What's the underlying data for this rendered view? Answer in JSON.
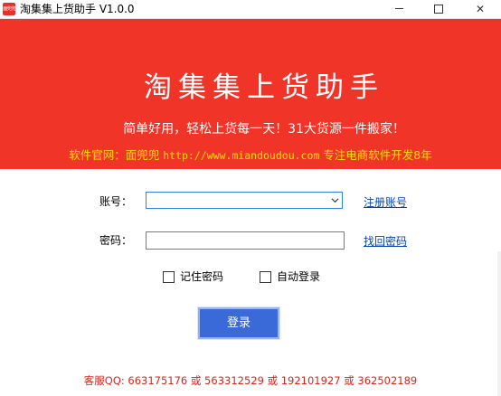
{
  "window": {
    "title": "淘集集上货助手 V1.0.0",
    "icon_text": "面兜兜",
    "controls": {
      "minimize": "minimize",
      "maximize": "maximize",
      "close": "✕"
    }
  },
  "banner": {
    "title": "淘集集上货助手",
    "slogan": "简单好用，轻松上货每一天！31大货源一件搬家！",
    "site_prefix": "软件官网：面兜兜 ",
    "site_url": "http://www.miandoudou.com",
    "site_suffix": " 专注电商软件开发8年"
  },
  "form": {
    "account_label": "账号：",
    "account_value": "",
    "password_label": "密码：",
    "password_value": "",
    "register_link": "注册账号",
    "recover_link": "找回密码",
    "remember_label": "记住密码",
    "auto_login_label": "自动登录",
    "login_button": "登录"
  },
  "footer": {
    "support": "客服QQ: 663175176 或 563312529 或 192101927 或 362502189"
  },
  "colors": {
    "banner": "#f03427",
    "site_text": "#ffe100",
    "button": "#3a6ad8",
    "support_text": "#d8241b"
  }
}
